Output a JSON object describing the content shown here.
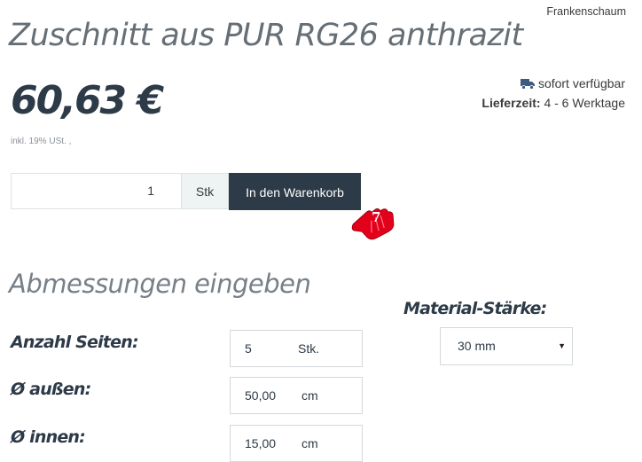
{
  "header": {
    "category": "Frankenschaum",
    "title": "Zuschnitt aus PUR RG26 anthrazit"
  },
  "price": {
    "amount": "60,63 €",
    "tax_note": "inkl. 19% USt. ,"
  },
  "availability": {
    "icon": "truck-icon",
    "status": "sofort verfügbar",
    "delivery_label": "Lieferzeit:",
    "delivery_value": "4 - 6 Werktage"
  },
  "cart": {
    "quantity": "1",
    "unit": "Stk",
    "button_label": "In den Warenkorb",
    "badge_number": "7",
    "accent_color": "#2d3a47",
    "badge_color": "#e3001b"
  },
  "dimensions": {
    "section_title": "Abmessungen eingeben",
    "fields": [
      {
        "label": "Anzahl Seiten:",
        "value": "5",
        "unit": "Stk."
      },
      {
        "label": "Ø außen:",
        "value": "50,00",
        "unit": "cm"
      },
      {
        "label": "Ø innen:",
        "value": "15,00",
        "unit": "cm"
      }
    ],
    "material_label": "Material-Stärke:",
    "material_value": "30 mm"
  }
}
